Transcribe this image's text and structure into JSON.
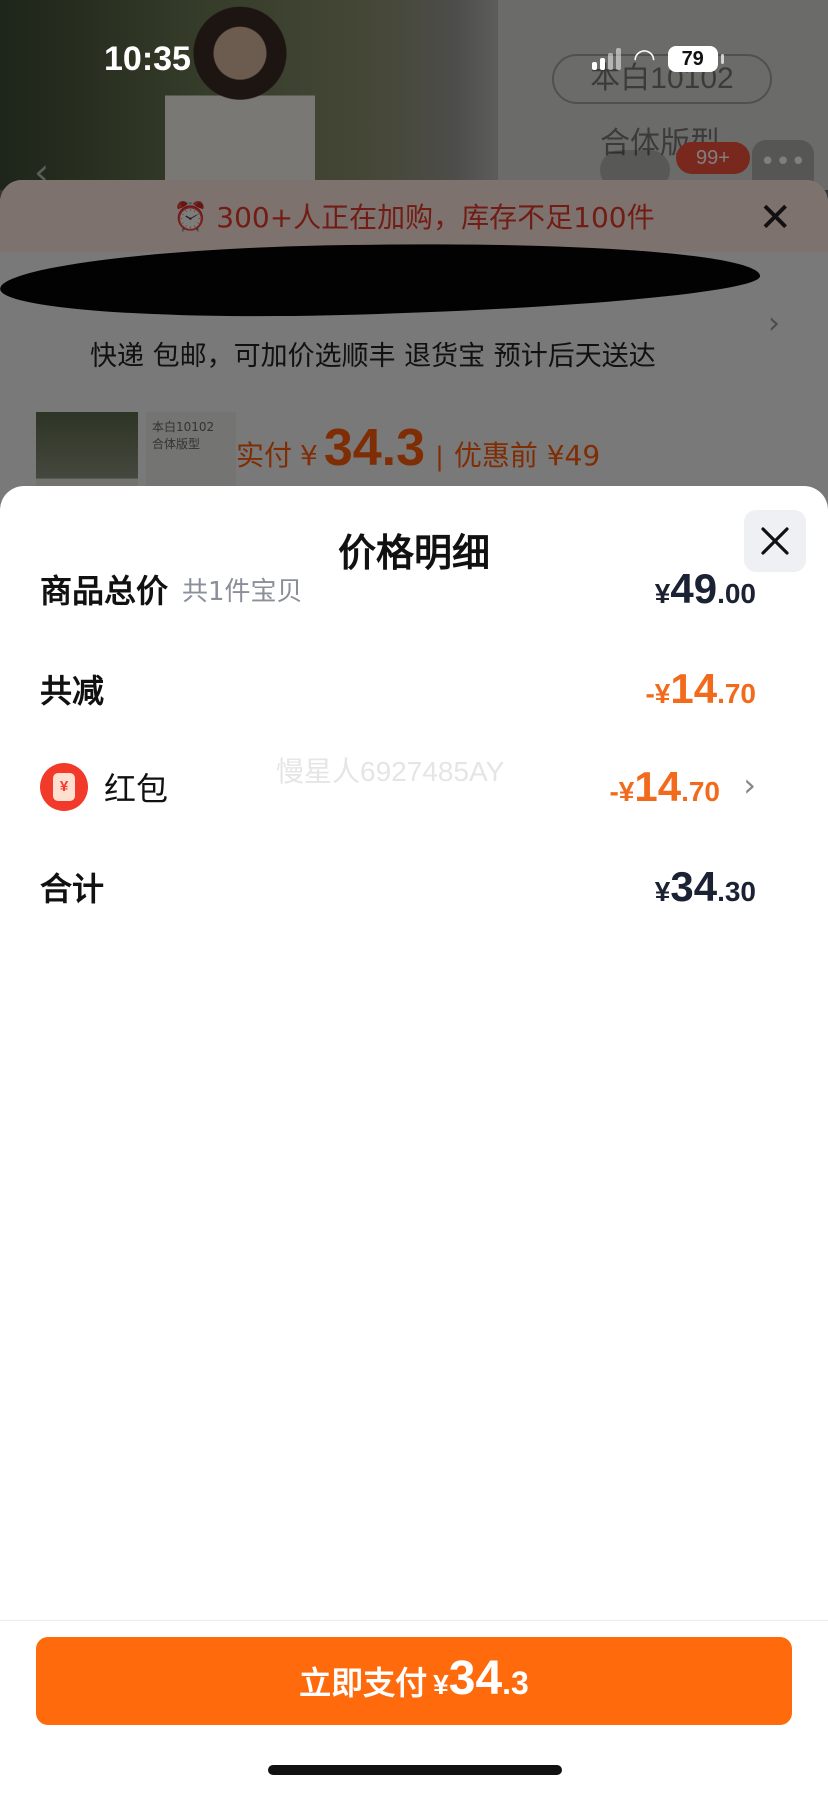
{
  "status_bar": {
    "time": "10:35",
    "battery": "79"
  },
  "background_page": {
    "hero_sku": "本白10102",
    "hero_fit": "合体版型",
    "cart_badge": "99+",
    "stock_warning": "300+人正在加购，库存不足100件",
    "delivery_info": "快递 包邮，可加价选顺丰 退货宝 预计后天送达",
    "paid_label": "实付",
    "paid_yen": "¥",
    "paid_amount": "34.3",
    "separator": "|",
    "original_price": "优惠前 ¥49",
    "thumb_sku": "本白10102",
    "thumb_fit": "合体版型"
  },
  "price_detail": {
    "title": "价格明细",
    "watermark": "慢星人6927485AY",
    "rows": [
      {
        "label": "商品总价",
        "sub": "共1件宝贝",
        "yen": "¥",
        "int": "49",
        "dec": ".00"
      },
      {
        "label": "共减",
        "yen": "-¥",
        "int": "14",
        "dec": ".70"
      },
      {
        "label": "红包",
        "icon_char": "¥",
        "yen": "-¥",
        "int": "14",
        "dec": ".70",
        "arrow": "›"
      },
      {
        "label": "合计",
        "yen": "¥",
        "int": "34",
        "dec": ".30"
      }
    ]
  },
  "pay_button": {
    "label": "立即支付",
    "yen": "¥",
    "int": "34",
    "dec": ".3"
  },
  "colors": {
    "accent": "#ff6a0d",
    "discount": "#f26a1b",
    "warning": "#e23a2a"
  }
}
